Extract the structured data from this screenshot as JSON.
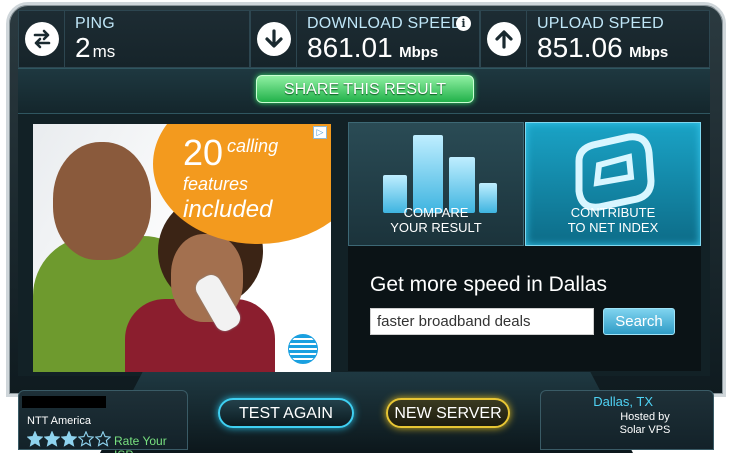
{
  "metrics": {
    "ping": {
      "label": "PING",
      "value": "2",
      "unit": "ms",
      "icon": "ping-arrows-icon"
    },
    "download": {
      "label": "DOWNLOAD SPEED",
      "value": "861.01",
      "unit": "Mbps",
      "icon": "download-arrow-icon",
      "info": "i"
    },
    "upload": {
      "label": "UPLOAD SPEED",
      "value": "851.06",
      "unit": "Mbps",
      "icon": "upload-arrow-icon"
    }
  },
  "share": {
    "label": "SHARE THIS RESULT"
  },
  "ad": {
    "number": "20",
    "line1": "calling",
    "line2": "features",
    "line3": "included",
    "adchoices": "▷"
  },
  "tiles": {
    "compare": {
      "line1": "COMPARE",
      "line2": "YOUR RESULT"
    },
    "contribute": {
      "line1": "CONTRIBUTE",
      "line2": "TO NET INDEX"
    }
  },
  "search": {
    "title": "Get more speed in Dallas",
    "input_value": "faster broadband deals",
    "button": "Search"
  },
  "isp": {
    "name": "NTT America",
    "rating": 3,
    "max_rating": 5,
    "rate_label": "Rate Your ISP"
  },
  "buttons": {
    "test_again": "TEST AGAIN",
    "new_server": "NEW SERVER"
  },
  "server": {
    "city": "Dallas, TX",
    "hosted_label": "Hosted by",
    "host": "Solar VPS"
  },
  "colors": {
    "accent": "#3fd0f2",
    "share_green": "#22b14a",
    "new_server_gold": "#e8c634",
    "star_filled": "#8fd3ee"
  }
}
